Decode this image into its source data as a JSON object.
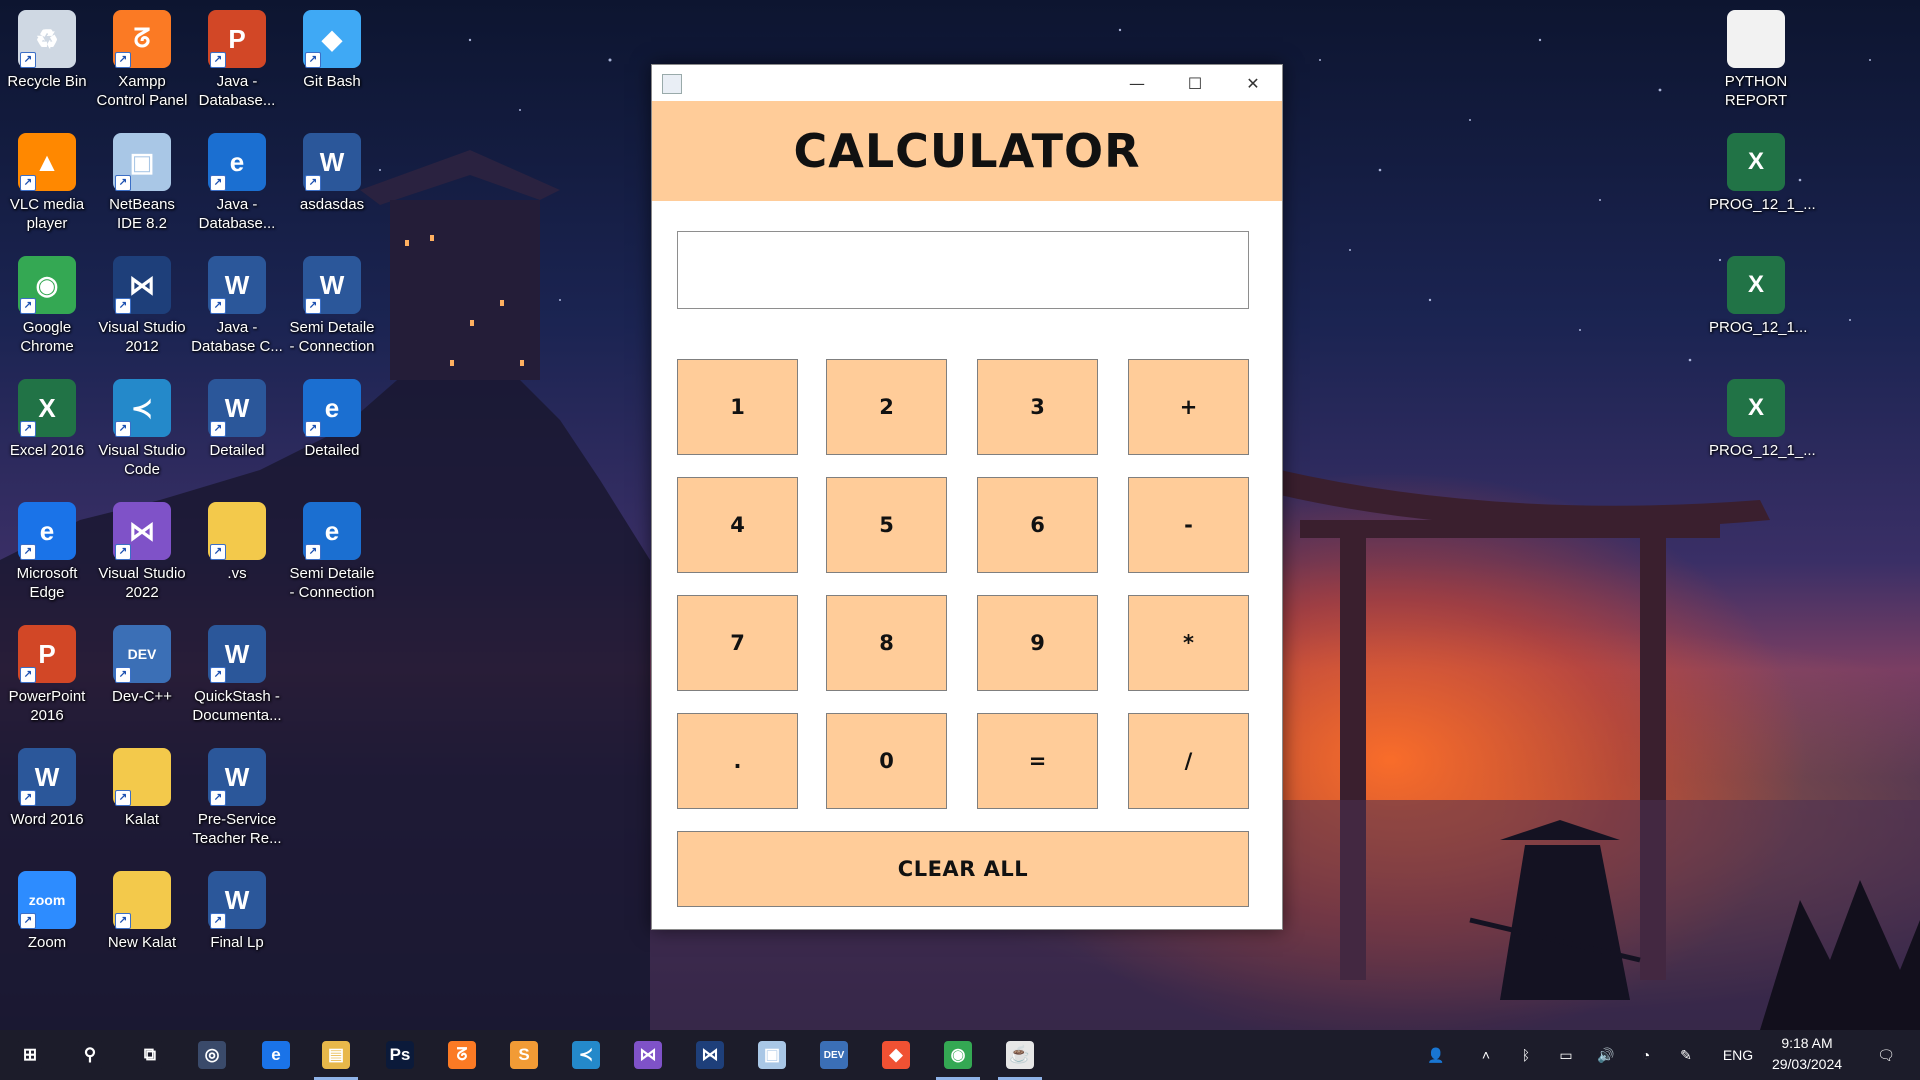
{
  "desktop": {
    "icons": [
      {
        "label": "Recycle Bin",
        "icon": "recycle-bin-icon",
        "color": "#cfd8e3"
      },
      {
        "label": "Xampp Control Panel",
        "icon": "xampp-icon",
        "color": "#fb7a24"
      },
      {
        "label": "Java - Database...",
        "icon": "powerpoint-doc-icon",
        "color": "#d24726"
      },
      {
        "label": "Git Bash",
        "icon": "git-bash-icon",
        "color": "#3fa9f5"
      },
      {
        "label": "VLC media player",
        "icon": "vlc-icon",
        "color": "#ff8800"
      },
      {
        "label": "NetBeans IDE 8.2",
        "icon": "netbeans-icon",
        "color": "#a9c7e6"
      },
      {
        "label": "Java - Database...",
        "icon": "pdf-doc-icon",
        "color": "#1b6fd1"
      },
      {
        "label": "asdasdas",
        "icon": "word-doc-icon",
        "color": "#2b579a"
      },
      {
        "label": "Google Chrome",
        "icon": "chrome-icon",
        "color": "#34a853"
      },
      {
        "label": "Visual Studio 2012",
        "icon": "visual-studio-2012-icon",
        "color": "#1e3f7a"
      },
      {
        "label": "Java - Database C...",
        "icon": "word-doc-icon",
        "color": "#2b579a"
      },
      {
        "label": "Semi Detaile - Connection",
        "icon": "word-doc-icon",
        "color": "#2b579a"
      },
      {
        "label": "Excel 2016",
        "icon": "excel-icon",
        "color": "#217346"
      },
      {
        "label": "Visual Studio Code",
        "icon": "vscode-icon",
        "color": "#2489ca"
      },
      {
        "label": "Detailed",
        "icon": "word-doc-icon",
        "color": "#2b579a"
      },
      {
        "label": "Detailed",
        "icon": "pdf-doc-icon",
        "color": "#1b6fd1"
      },
      {
        "label": "Microsoft Edge",
        "icon": "edge-icon",
        "color": "#1a73e8"
      },
      {
        "label": "Visual Studio 2022",
        "icon": "visual-studio-2022-icon",
        "color": "#7f52c8"
      },
      {
        "label": ".vs",
        "icon": "folder-icon",
        "color": "#f3c94b"
      },
      {
        "label": "Semi Detaile - Connection",
        "icon": "pdf-doc-icon",
        "color": "#1b6fd1"
      },
      {
        "label": "PowerPoint 2016",
        "icon": "powerpoint-icon",
        "color": "#d24726"
      },
      {
        "label": "Dev-C++",
        "icon": "devcpp-icon",
        "color": "#3b6fb6"
      },
      {
        "label": "QuickStash - Documenta...",
        "icon": "word-doc-icon",
        "color": "#2b579a"
      },
      {
        "label": "Word 2016",
        "icon": "word-icon",
        "color": "#2b579a"
      },
      {
        "label": "Kalat",
        "icon": "folder-icon",
        "color": "#f3c94b"
      },
      {
        "label": "Pre-Service Teacher Re...",
        "icon": "word-doc-icon",
        "color": "#2b579a"
      },
      {
        "label": "Zoom",
        "icon": "zoom-icon",
        "color": "#2d8cff"
      },
      {
        "label": "New Kalat",
        "icon": "folder-icon",
        "color": "#f3c94b"
      },
      {
        "label": "Final Lp",
        "icon": "word-doc-icon",
        "color": "#2b579a"
      }
    ],
    "right_icons": [
      {
        "label": "PYTHON REPORT",
        "icon": "blank-doc-icon",
        "color": "#f2f2f2"
      },
      {
        "label": "PROG_12_1_...",
        "icon": "excel-doc-icon",
        "color": "#217346"
      },
      {
        "label": "PROG_12_1...",
        "icon": "excel-doc-icon",
        "color": "#217346"
      },
      {
        "label": "PROG_12_1_...",
        "icon": "excel-doc-icon",
        "color": "#217346"
      }
    ]
  },
  "window": {
    "title": "",
    "app_icon": "java-app-icon",
    "header": "CALCULATOR",
    "header_color": "#FFCC99",
    "display_value": "",
    "keys": [
      "1",
      "2",
      "3",
      "+",
      "4",
      "5",
      "6",
      "-",
      "7",
      "8",
      "9",
      "*",
      ".",
      "0",
      "=",
      "/"
    ],
    "clear_label": "CLEAR ALL",
    "controls": {
      "minimize": "—",
      "maximize": "☐",
      "close": "✕"
    }
  },
  "taskbar": {
    "apps": [
      {
        "icon": "start-icon"
      },
      {
        "icon": "search-icon"
      },
      {
        "icon": "task-view-icon"
      },
      {
        "icon": "camera-icon"
      },
      {
        "icon": "edge-icon"
      },
      {
        "icon": "file-explorer-icon"
      },
      {
        "icon": "photoshop-icon"
      },
      {
        "icon": "xampp-icon"
      },
      {
        "icon": "sublime-icon"
      },
      {
        "icon": "vscode-icon"
      },
      {
        "icon": "visual-studio-2022-icon"
      },
      {
        "icon": "visual-studio-2012-icon"
      },
      {
        "icon": "netbeans-icon"
      },
      {
        "icon": "devcpp-icon"
      },
      {
        "icon": "git-icon"
      },
      {
        "icon": "chrome-icon"
      },
      {
        "icon": "java-app-icon"
      }
    ],
    "tray": {
      "language": "ENG",
      "time": "9:18 AM",
      "date": "29/03/2024"
    }
  }
}
